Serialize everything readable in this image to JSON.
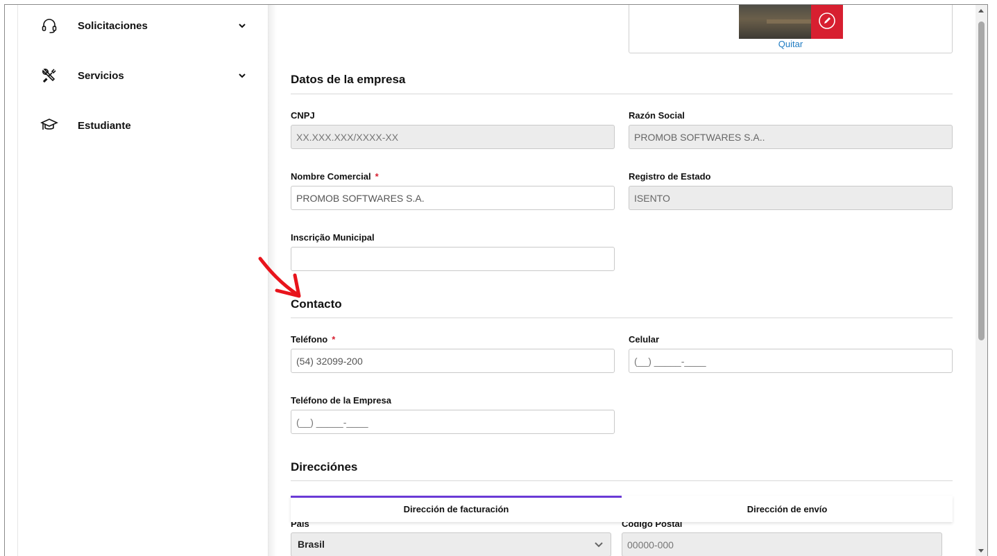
{
  "sidebar": {
    "items": [
      {
        "label": "Solicitaciones",
        "icon": "headset-icon",
        "has_chevron": true
      },
      {
        "label": "Servicios",
        "icon": "tools-icon",
        "has_chevron": true
      },
      {
        "label": "Estudiante",
        "icon": "graduation-cap-icon",
        "has_chevron": false
      }
    ]
  },
  "logo": {
    "remove_label": "Quitar",
    "edit_icon": "pencil-icon"
  },
  "company": {
    "title": "Datos de la empresa",
    "cnpj_label": "CNPJ",
    "cnpj_placeholder": "XX.XXX.XXX/XXXX-XX",
    "razon_label": "Razón Social",
    "razon_value": "PROMOB SOFTWARES S.A..",
    "nombre_label": "Nombre Comercial",
    "nombre_required": "*",
    "nombre_value": "PROMOB SOFTWARES S.A.",
    "registro_label": "Registro de Estado",
    "registro_value": "ISENTO",
    "inscricao_label": "Inscrição Municipal",
    "inscricao_value": ""
  },
  "contact": {
    "title": "Contacto",
    "telefono_label": "Teléfono",
    "telefono_required": "*",
    "telefono_value": "(54) 32099-200",
    "celular_label": "Celular",
    "celular_placeholder": "(__) _____-____",
    "tel_empresa_label": "Teléfono de la Empresa",
    "tel_empresa_placeholder": "(__) _____-____"
  },
  "addresses": {
    "title": "Direcciónes",
    "tabs": [
      {
        "label": "Dirección de facturación",
        "active": true
      },
      {
        "label": "Dirección de envío",
        "active": false
      }
    ],
    "pais_label": "País",
    "pais_value": "Brasil",
    "cp_label": "Código Postal",
    "cp_placeholder": "00000-000"
  },
  "colors": {
    "accent_tab": "#6a3ad6",
    "edit_button": "#d71f30",
    "required": "#d71f30",
    "link": "#1e7bc2",
    "annotation_arrow": "#e8141c"
  }
}
